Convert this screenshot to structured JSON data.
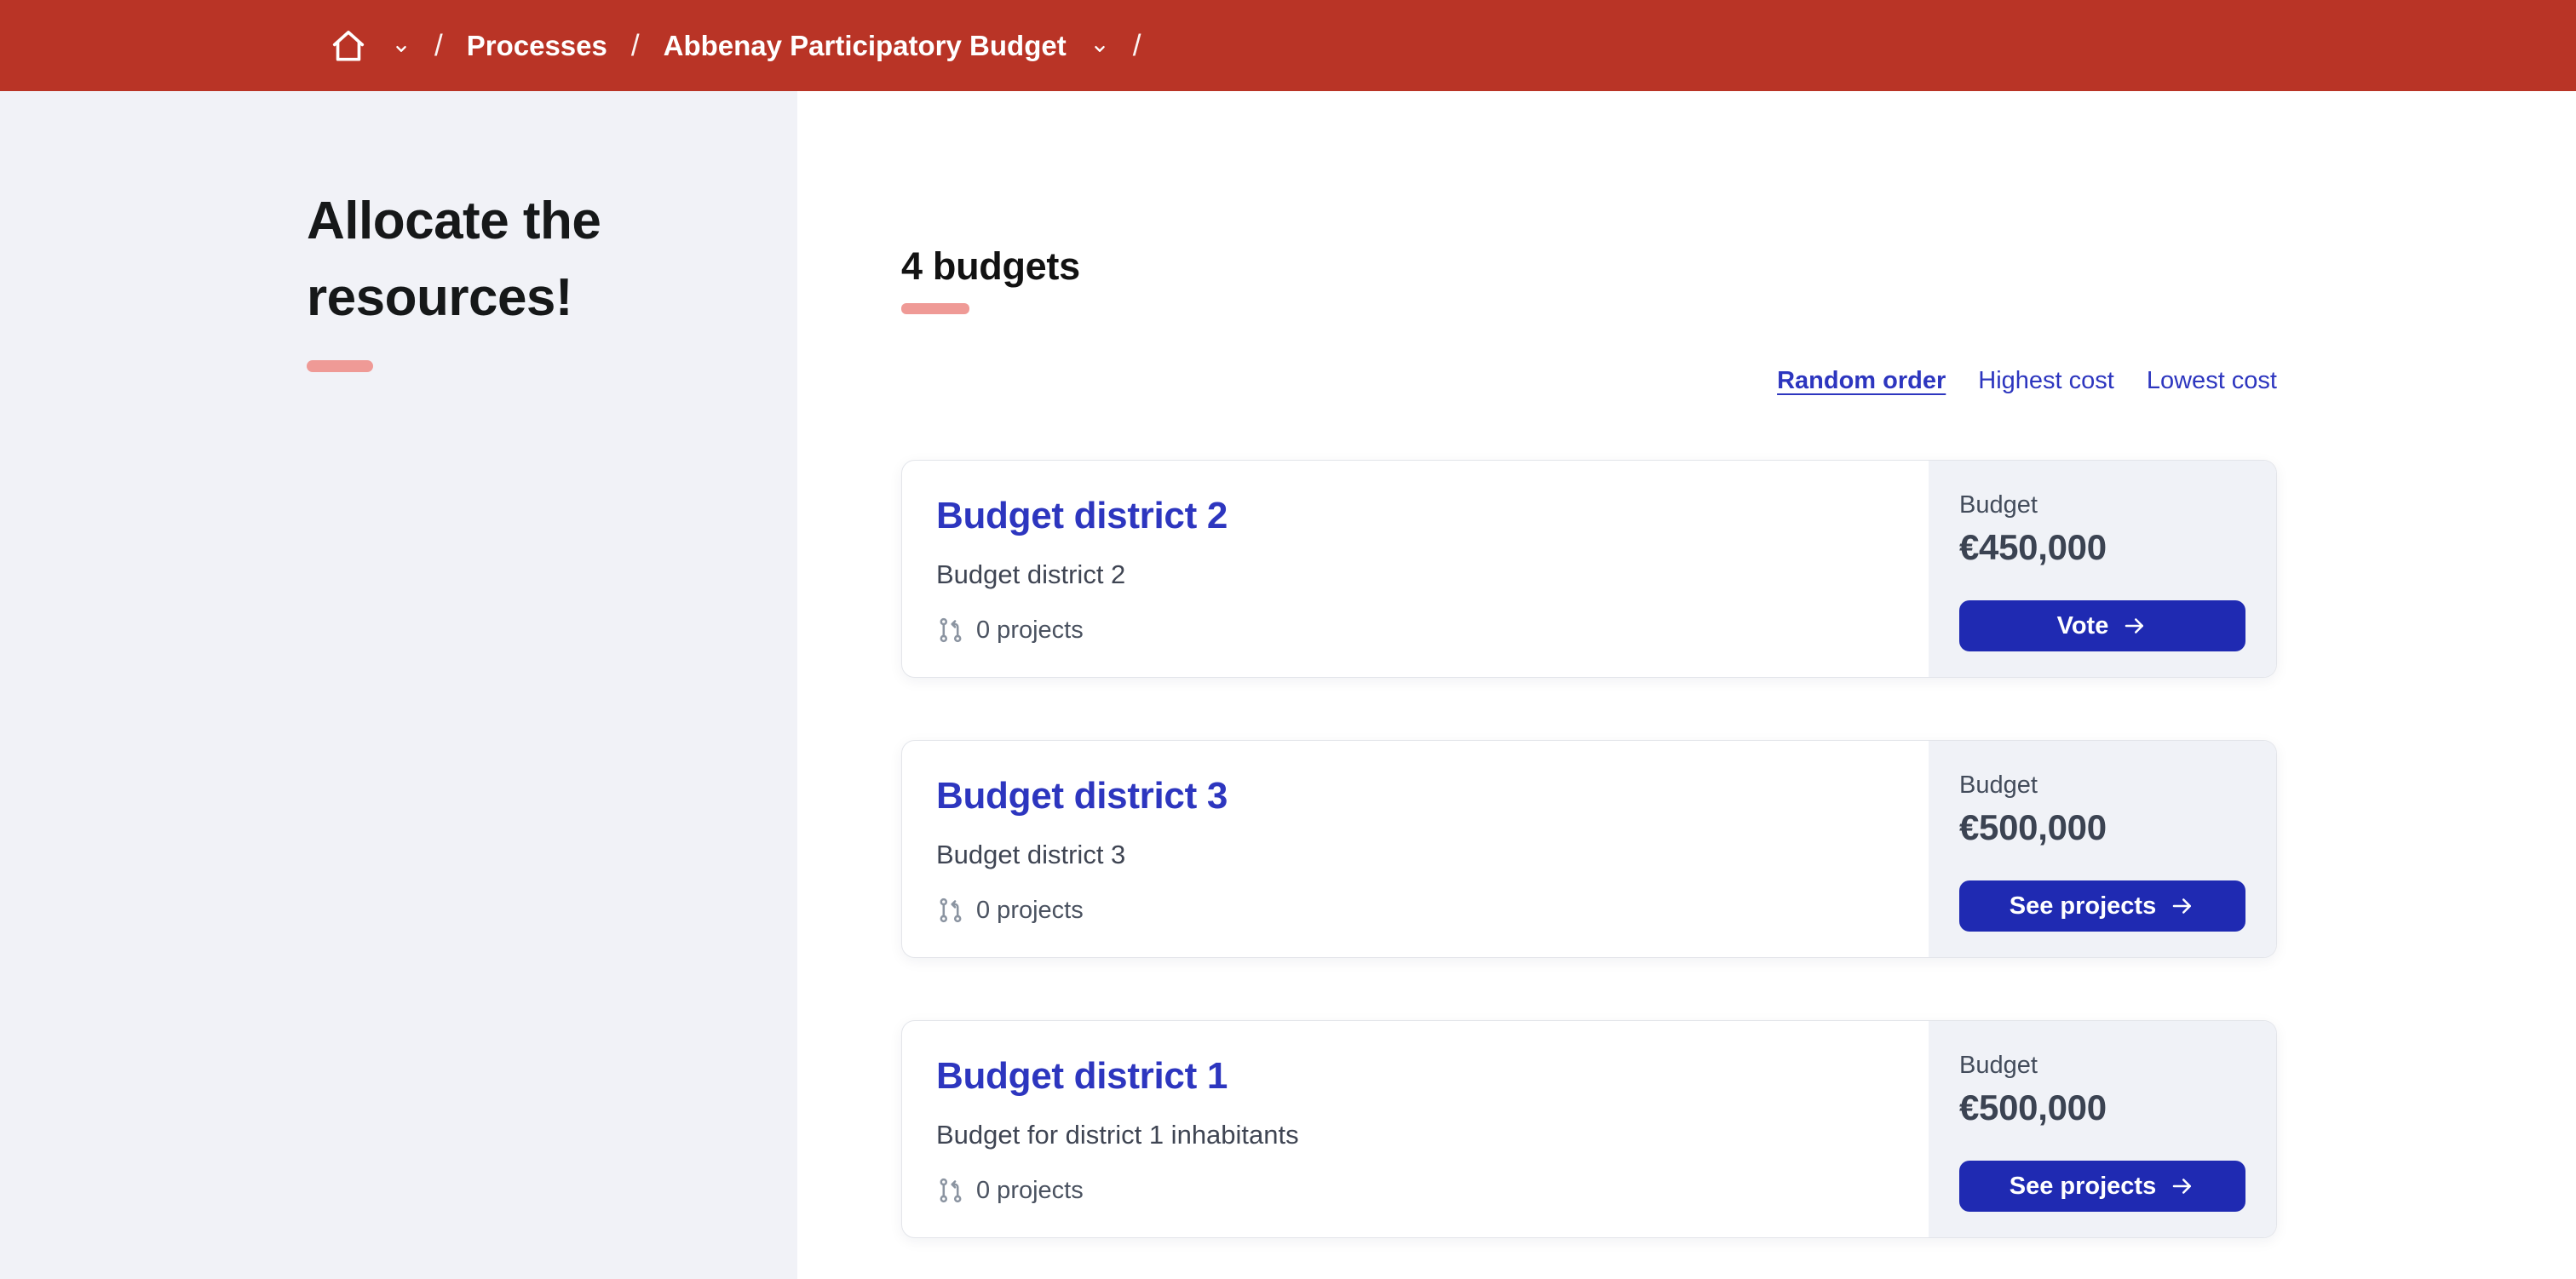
{
  "theme": {
    "header_red": "#b93426",
    "link_blue": "#2d36bf",
    "button_blue": "#1f2ab2",
    "salmon_accent": "#ef9a96",
    "sidebar_gray": "#f1f2f7",
    "panel_gray": "#f0f2f7"
  },
  "icons": {
    "home": "home-icon",
    "chevron_down": "chevron-down-icon",
    "projects": "git-pull-request-icon",
    "arrow_right": "arrow-right-icon"
  },
  "header": {
    "breadcrumb": {
      "separator": "/",
      "processes": "Processes",
      "process": "Abbenay Participatory Budget"
    }
  },
  "sidebar": {
    "title": "Allocate the resources!"
  },
  "main": {
    "heading": "4 budgets",
    "order": {
      "random": "Random order",
      "highest": "Highest cost",
      "lowest": "Lowest cost"
    },
    "cards": [
      {
        "title": "Budget district 2",
        "description": "Budget district 2",
        "projects_count": "0 projects",
        "budget_label": "Budget",
        "amount": "€450,000",
        "button_label": "Vote"
      },
      {
        "title": "Budget district 3",
        "description": "Budget district 3",
        "projects_count": "0 projects",
        "budget_label": "Budget",
        "amount": "€500,000",
        "button_label": "See projects"
      },
      {
        "title": "Budget district 1",
        "description": "Budget for district 1 inhabitants",
        "projects_count": "0 projects",
        "budget_label": "Budget",
        "amount": "€500,000",
        "button_label": "See projects"
      }
    ]
  }
}
